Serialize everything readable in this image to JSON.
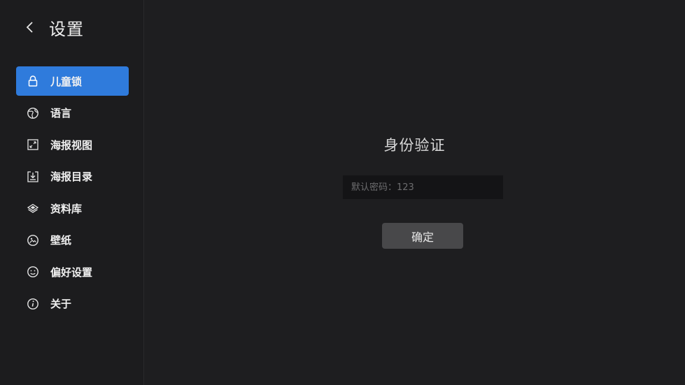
{
  "header": {
    "back_icon": "chevron-left-icon",
    "title": "设置"
  },
  "sidebar": {
    "items": [
      {
        "id": "child-lock",
        "label": "儿童锁",
        "icon": "lock-icon",
        "active": true
      },
      {
        "id": "language",
        "label": "语言",
        "icon": "globe-icon",
        "active": false
      },
      {
        "id": "poster-view",
        "label": "海报视图",
        "icon": "expand-icon",
        "active": false
      },
      {
        "id": "poster-directory",
        "label": "海报目录",
        "icon": "tray-download-icon",
        "active": false
      },
      {
        "id": "library",
        "label": "资料库",
        "icon": "layers-icon",
        "active": false
      },
      {
        "id": "wallpaper",
        "label": "壁纸",
        "icon": "image-icon",
        "active": false
      },
      {
        "id": "preferences",
        "label": "偏好设置",
        "icon": "smile-icon",
        "active": false
      },
      {
        "id": "about",
        "label": "关于",
        "icon": "info-icon",
        "active": false
      }
    ]
  },
  "auth": {
    "title": "身份验证",
    "password_placeholder": "默认密码：123",
    "password_value": "",
    "confirm_label": "确定"
  },
  "colors": {
    "accent": "#2f7bdc",
    "background": "#1e1e20",
    "input_bg": "#141416",
    "button_bg": "#48484a"
  }
}
